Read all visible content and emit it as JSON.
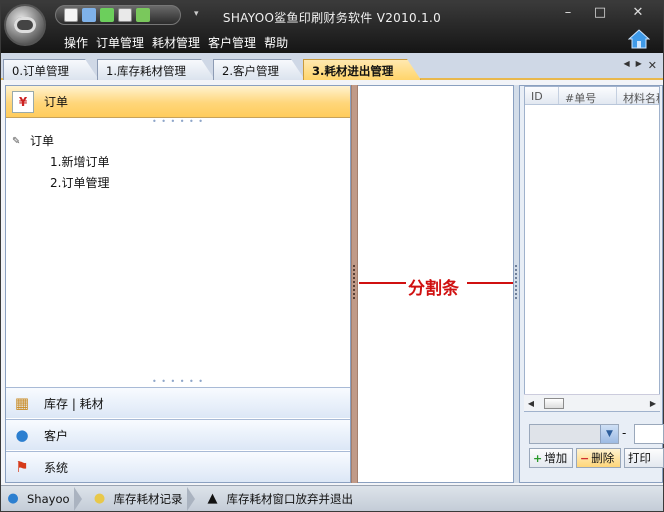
{
  "window": {
    "title": "SHAYOO鲨鱼印刷财务软件 V2010.1.0",
    "controls": [
      "–",
      "□",
      "✕"
    ]
  },
  "menu": [
    "操作",
    "订单管理",
    "耗材管理",
    "客户管理",
    "帮助"
  ],
  "tabs": [
    {
      "label": "0.订单管理",
      "active": false
    },
    {
      "label": "1.库存耗材管理",
      "active": false
    },
    {
      "label": "2.客户管理",
      "active": false
    },
    {
      "label": "3.耗材进出管理",
      "active": true
    }
  ],
  "tab_nav": {
    "prev": "◀",
    "next": "▶",
    "close": "✕"
  },
  "left_panel": {
    "header": {
      "title": "订单",
      "icon_glyph": "¥"
    },
    "tree": {
      "root": "订单",
      "children": [
        "1.新增订单",
        "2.订单管理"
      ]
    },
    "nav_groups": [
      {
        "label": "库存 | 耗材"
      },
      {
        "label": "客户"
      },
      {
        "label": "系统"
      }
    ]
  },
  "annotation": {
    "label": "分割条"
  },
  "grid": {
    "columns": [
      "ID",
      "#单号",
      "材料名称"
    ]
  },
  "controls": {
    "range_separator": "-",
    "buttons": [
      {
        "label": "增加",
        "icon": "+"
      },
      {
        "label": "删除",
        "icon": "−"
      },
      {
        "label": "打印"
      }
    ]
  },
  "statusbar": {
    "user": "Shayoo",
    "tip_label": "库存耗材记录",
    "message": "库存耗材窗口放弃并退出"
  },
  "colors": {
    "accent": "#ffd46a",
    "splitter": "#c09a88",
    "annotation": "#d01010"
  }
}
